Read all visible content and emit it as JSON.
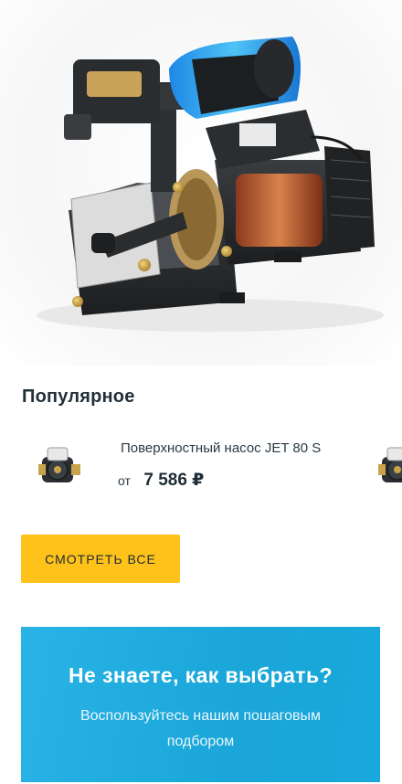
{
  "hero": {
    "icon": "pump-product-image"
  },
  "popular": {
    "title": "Популярное",
    "product": {
      "name": "Поверхностный насос JET 80 S",
      "price_from": "от",
      "price": "7 586 ₽",
      "icon": "circulation-pump-icon"
    },
    "next_icon": "circulation-pump-icon"
  },
  "cta": {
    "label": "Смотреть все"
  },
  "promo": {
    "title": "Не знаете, как выбрать?",
    "subtitle": "Воспользуйтесь нашим пошаговым подбором"
  },
  "colors": {
    "accent": "#fec21a",
    "promo_blue": "#1ba8db"
  }
}
